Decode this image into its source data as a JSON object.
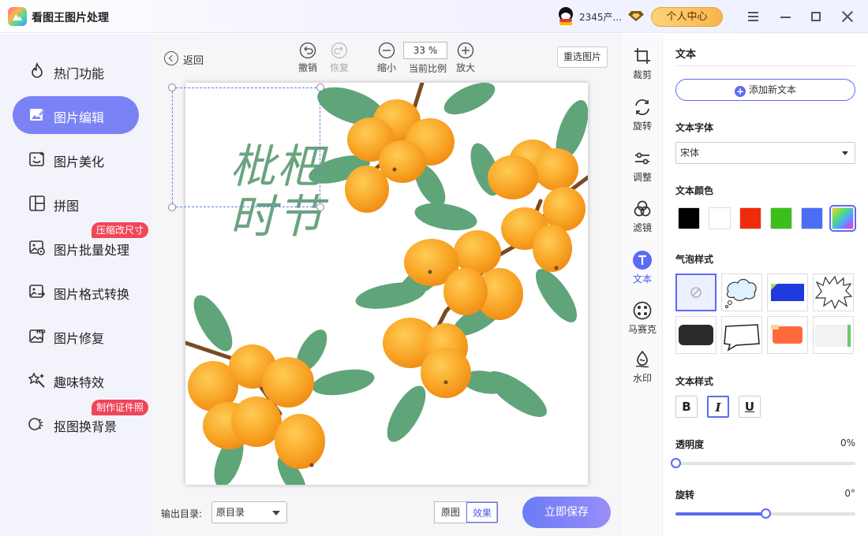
{
  "app": {
    "title": "看图王图片处理"
  },
  "header": {
    "user_name": "2345产...",
    "personal_center": "个人中心"
  },
  "sidebar": {
    "items": [
      {
        "label": "热门功能",
        "icon": "flame-icon"
      },
      {
        "label": "图片编辑",
        "icon": "image-edit-icon",
        "active": true
      },
      {
        "label": "图片美化",
        "icon": "image-beautify-icon"
      },
      {
        "label": "拼图",
        "icon": "collage-icon"
      },
      {
        "label": "图片批量处理",
        "icon": "batch-icon",
        "badge": "压缩改尺寸"
      },
      {
        "label": "图片格式转换",
        "icon": "format-convert-icon"
      },
      {
        "label": "图片修复",
        "icon": "hd-repair-icon"
      },
      {
        "label": "趣味特效",
        "icon": "magic-wand-icon"
      },
      {
        "label": "抠图换背景",
        "icon": "cutout-icon",
        "badge": "制作证件照"
      }
    ]
  },
  "toolbar": {
    "back": "返回",
    "undo": "撤销",
    "redo": "恢复",
    "zoom_out": "缩小",
    "zoom_value": "33 %",
    "zoom_label": "当前比例",
    "zoom_in": "放大",
    "reselect": "重选图片"
  },
  "canvas": {
    "poster_text_line1": "枇杷",
    "poster_text_line2": "时节"
  },
  "bottom": {
    "output_label": "输出目录:",
    "output_value": "原目录",
    "original": "原图",
    "effect": "效果",
    "save": "立即保存"
  },
  "rail": {
    "items": [
      {
        "label": "裁剪",
        "icon": "crop-icon"
      },
      {
        "label": "旋转",
        "icon": "rotate-icon"
      },
      {
        "label": "调整",
        "icon": "adjust-icon"
      },
      {
        "label": "滤镜",
        "icon": "filter-icon"
      },
      {
        "label": "文本",
        "icon": "text-icon",
        "active": true
      },
      {
        "label": "马赛克",
        "icon": "mosaic-icon"
      },
      {
        "label": "水印",
        "icon": "watermark-icon"
      }
    ]
  },
  "panel": {
    "title": "文本",
    "add_text": "添加新文本",
    "font_label": "文本字体",
    "font_value": "宋体",
    "color_label": "文本颜色",
    "colors": [
      "#000000",
      "#ffffff",
      "#f02a0c",
      "#3cbf1a",
      "#4c6ef5",
      "rainbow"
    ],
    "selected_color": "rainbow",
    "bubble_label": "气泡样式",
    "style_label": "文本样式",
    "styles": {
      "bold": "B",
      "italic": "I",
      "underline": "U"
    },
    "opacity_label": "透明度",
    "opacity_value": "0%",
    "opacity_level": 0,
    "rotate_label": "旋转",
    "rotate_value": "0°",
    "rotate_level": 0.5
  }
}
